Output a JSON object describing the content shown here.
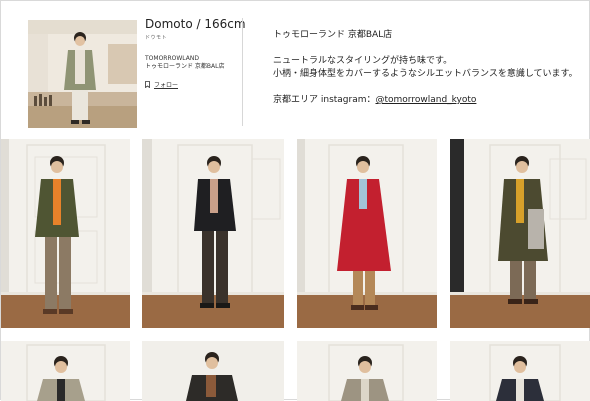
{
  "profile": {
    "name": "Domoto / 166cm",
    "kana": "ドウモト",
    "brand": "TOMORROWLAND",
    "shop": "トゥモローランド 京都BAL店",
    "follow_label": "フォロー",
    "follow_icon": "bookmark-icon"
  },
  "description": {
    "line1": "トゥモローランド 京都BAL店",
    "line2": "ニュートラルなスタイリングが持ち味です。",
    "line3": "小柄・細身体型をカバーするようなシルエットバランスを意識しています。",
    "instagram_prefix": "京都エリア instagram：",
    "instagram_handle": "@tomorrowland_kyoto"
  },
  "colors": {
    "wall": "#f3f1ec",
    "floor": "#9a6a44",
    "accent_red": "#c3202f"
  }
}
